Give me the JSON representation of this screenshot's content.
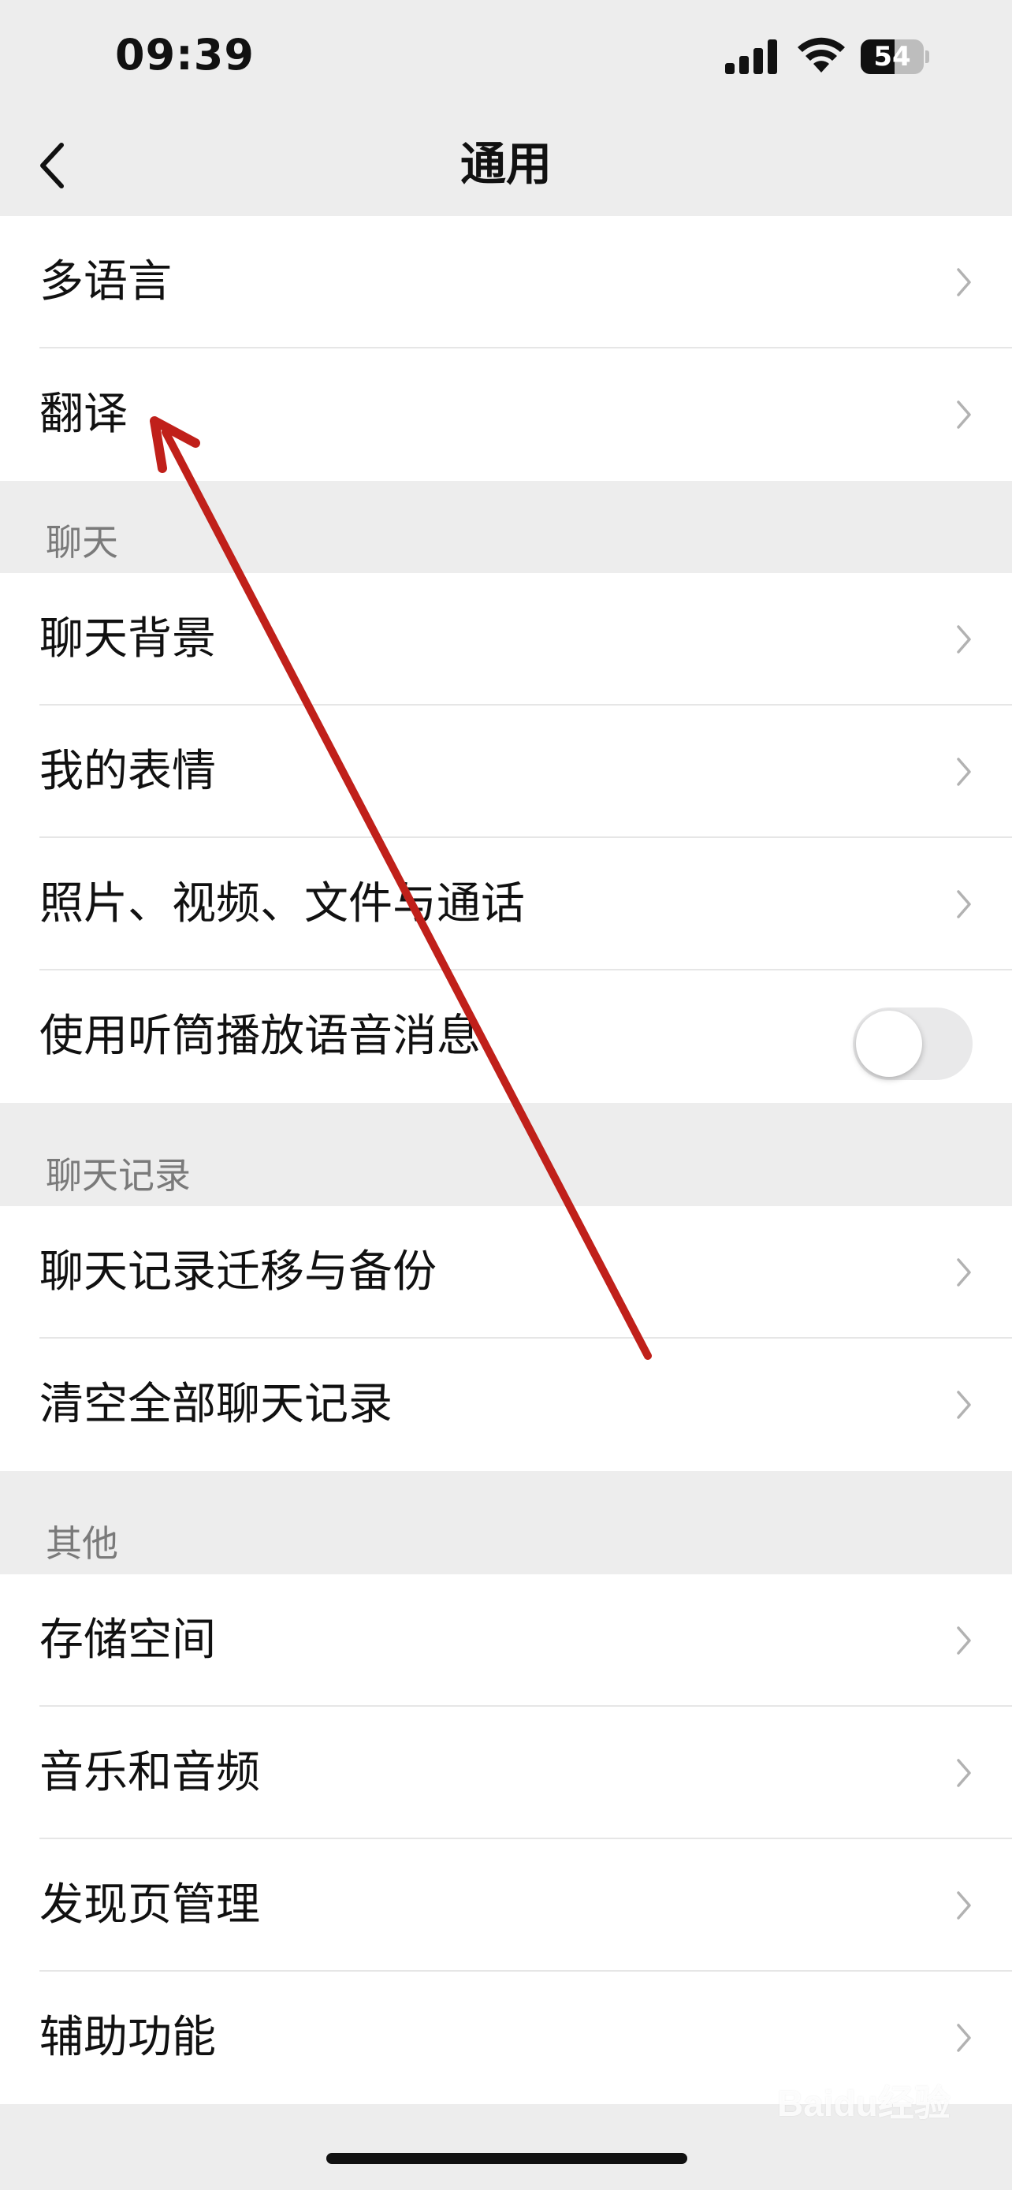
{
  "status_bar": {
    "time": "09:39",
    "battery_level": "54"
  },
  "nav": {
    "title": "通用"
  },
  "groups": {
    "top": {
      "items": [
        "多语言",
        "翻译"
      ]
    },
    "chat": {
      "header": "聊天",
      "items": [
        "聊天背景",
        "我的表情",
        "照片、视频、文件与通话",
        "使用听筒播放语音消息"
      ]
    },
    "chat_history": {
      "header": "聊天记录",
      "items": [
        "聊天记录迁移与备份",
        "清空全部聊天记录"
      ]
    },
    "other": {
      "header": "其他",
      "items": [
        "存储空间",
        "音乐和音频",
        "发现页管理",
        "辅助功能"
      ]
    }
  },
  "toggles": {
    "earpiece_playback": false
  },
  "watermark": {
    "text": "Baidu经验"
  },
  "colors": {
    "background": "#ededed",
    "arrow": "#c0201a",
    "section_text": "#7a7a7a"
  }
}
